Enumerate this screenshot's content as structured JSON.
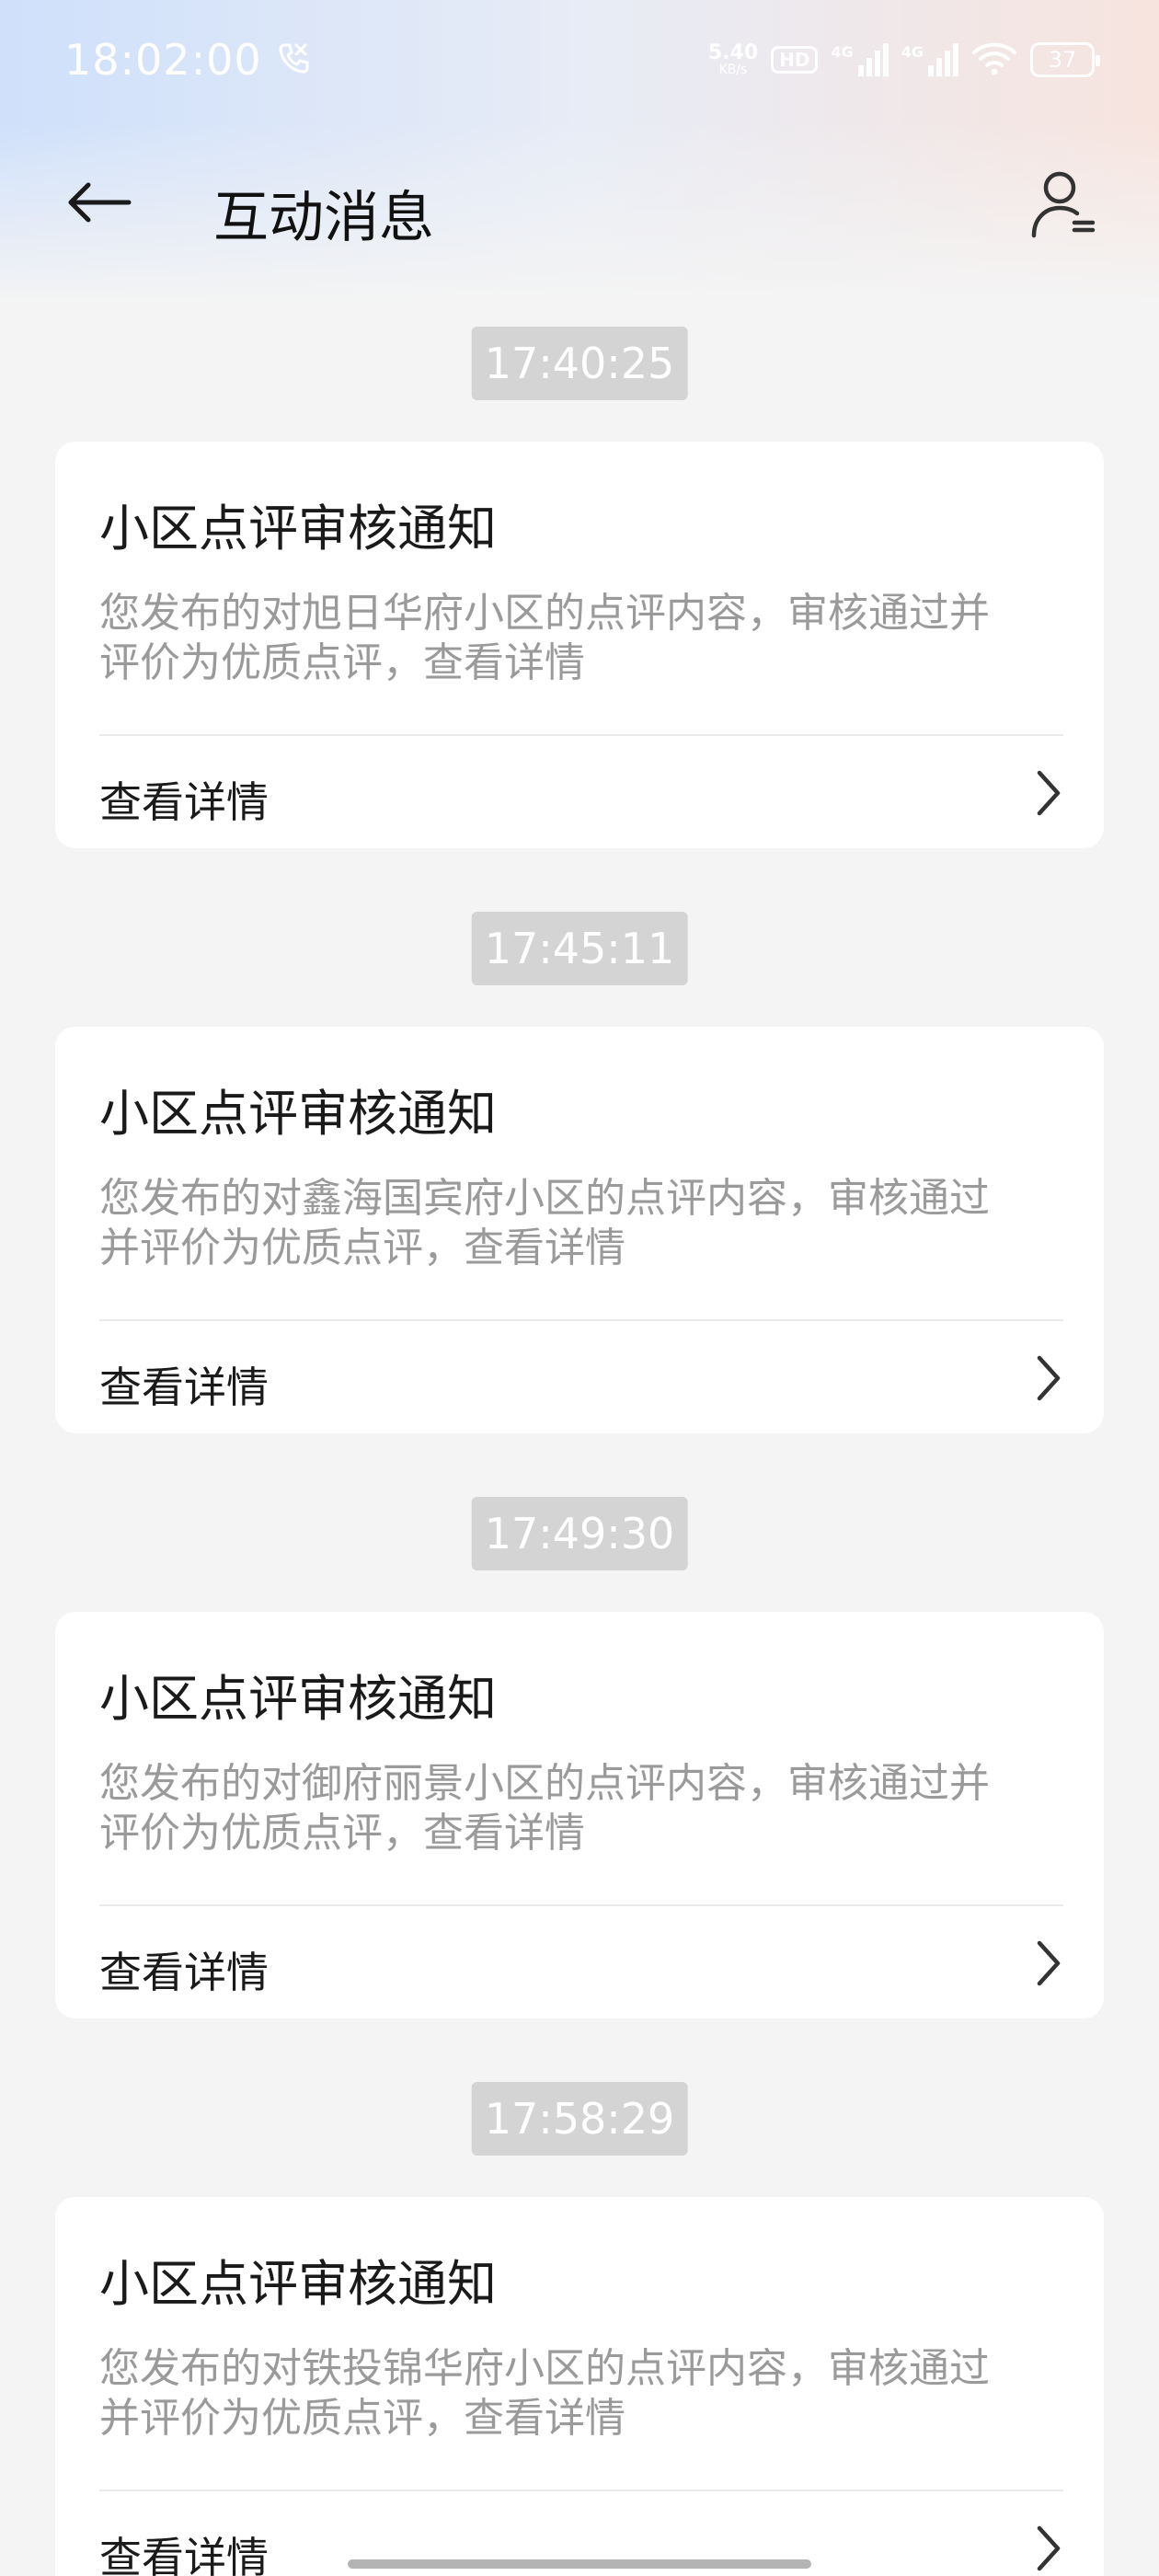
{
  "status_bar": {
    "time": "18:02:00",
    "net_speed_value": "5.40",
    "net_speed_unit": "KB/s",
    "hd_label": "HD",
    "signal1_label": "4G",
    "signal2_label": "4G",
    "battery": "37",
    "call_icon": "phone-call-icon",
    "wifi_icon": "wifi-icon"
  },
  "header": {
    "title": "互动消息",
    "back_icon": "back-arrow-icon",
    "profile_icon": "user-settings-icon"
  },
  "messages": [
    {
      "time": "17:40:25",
      "title": "小区点评审核通知",
      "body_line1": "您发布的对旭日华府小区的点评内容，审核通过并",
      "body_line2": "评价为优质点评，查看详情",
      "action": "查看详情"
    },
    {
      "time": "17:45:11",
      "title": "小区点评审核通知",
      "body_line1": "您发布的对鑫海国宾府小区的点评内容，审核通过",
      "body_line2": "并评价为优质点评，查看详情",
      "action": "查看详情"
    },
    {
      "time": "17:49:30",
      "title": "小区点评审核通知",
      "body_line1": "您发布的对御府丽景小区的点评内容，审核通过并",
      "body_line2": "评价为优质点评，查看详情",
      "action": "查看详情"
    },
    {
      "time": "17:58:29",
      "title": "小区点评审核通知",
      "body_line1": "您发布的对铁投锦华府小区的点评内容，审核通过",
      "body_line2": "并评价为优质点评，查看详情",
      "action": "查看详情"
    }
  ]
}
